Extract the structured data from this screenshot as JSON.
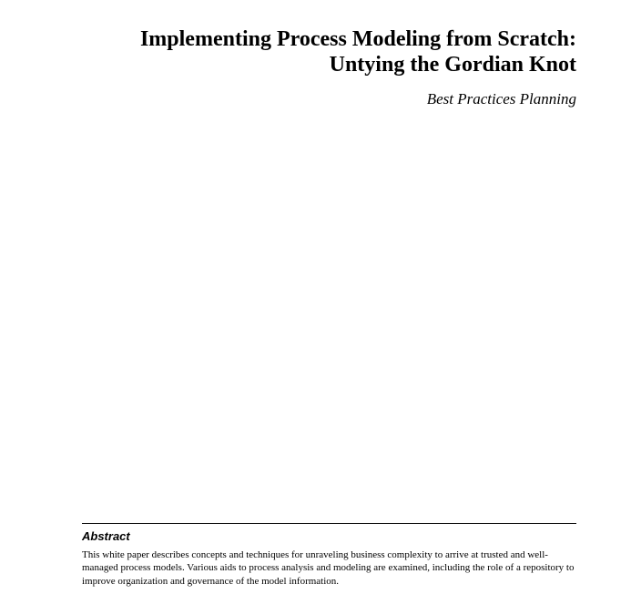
{
  "title": {
    "line1": "Implementing Process Modeling from Scratch:",
    "line2": "Untying the Gordian Knot"
  },
  "subtitle": "Best Practices Planning",
  "abstract": {
    "heading": "Abstract",
    "body": "This white paper describes concepts and techniques for unraveling business complexity to arrive at trusted and well-managed process models.  Various aids to process analysis and modeling are examined, including the role of a repository to improve organization and governance of the model information."
  }
}
